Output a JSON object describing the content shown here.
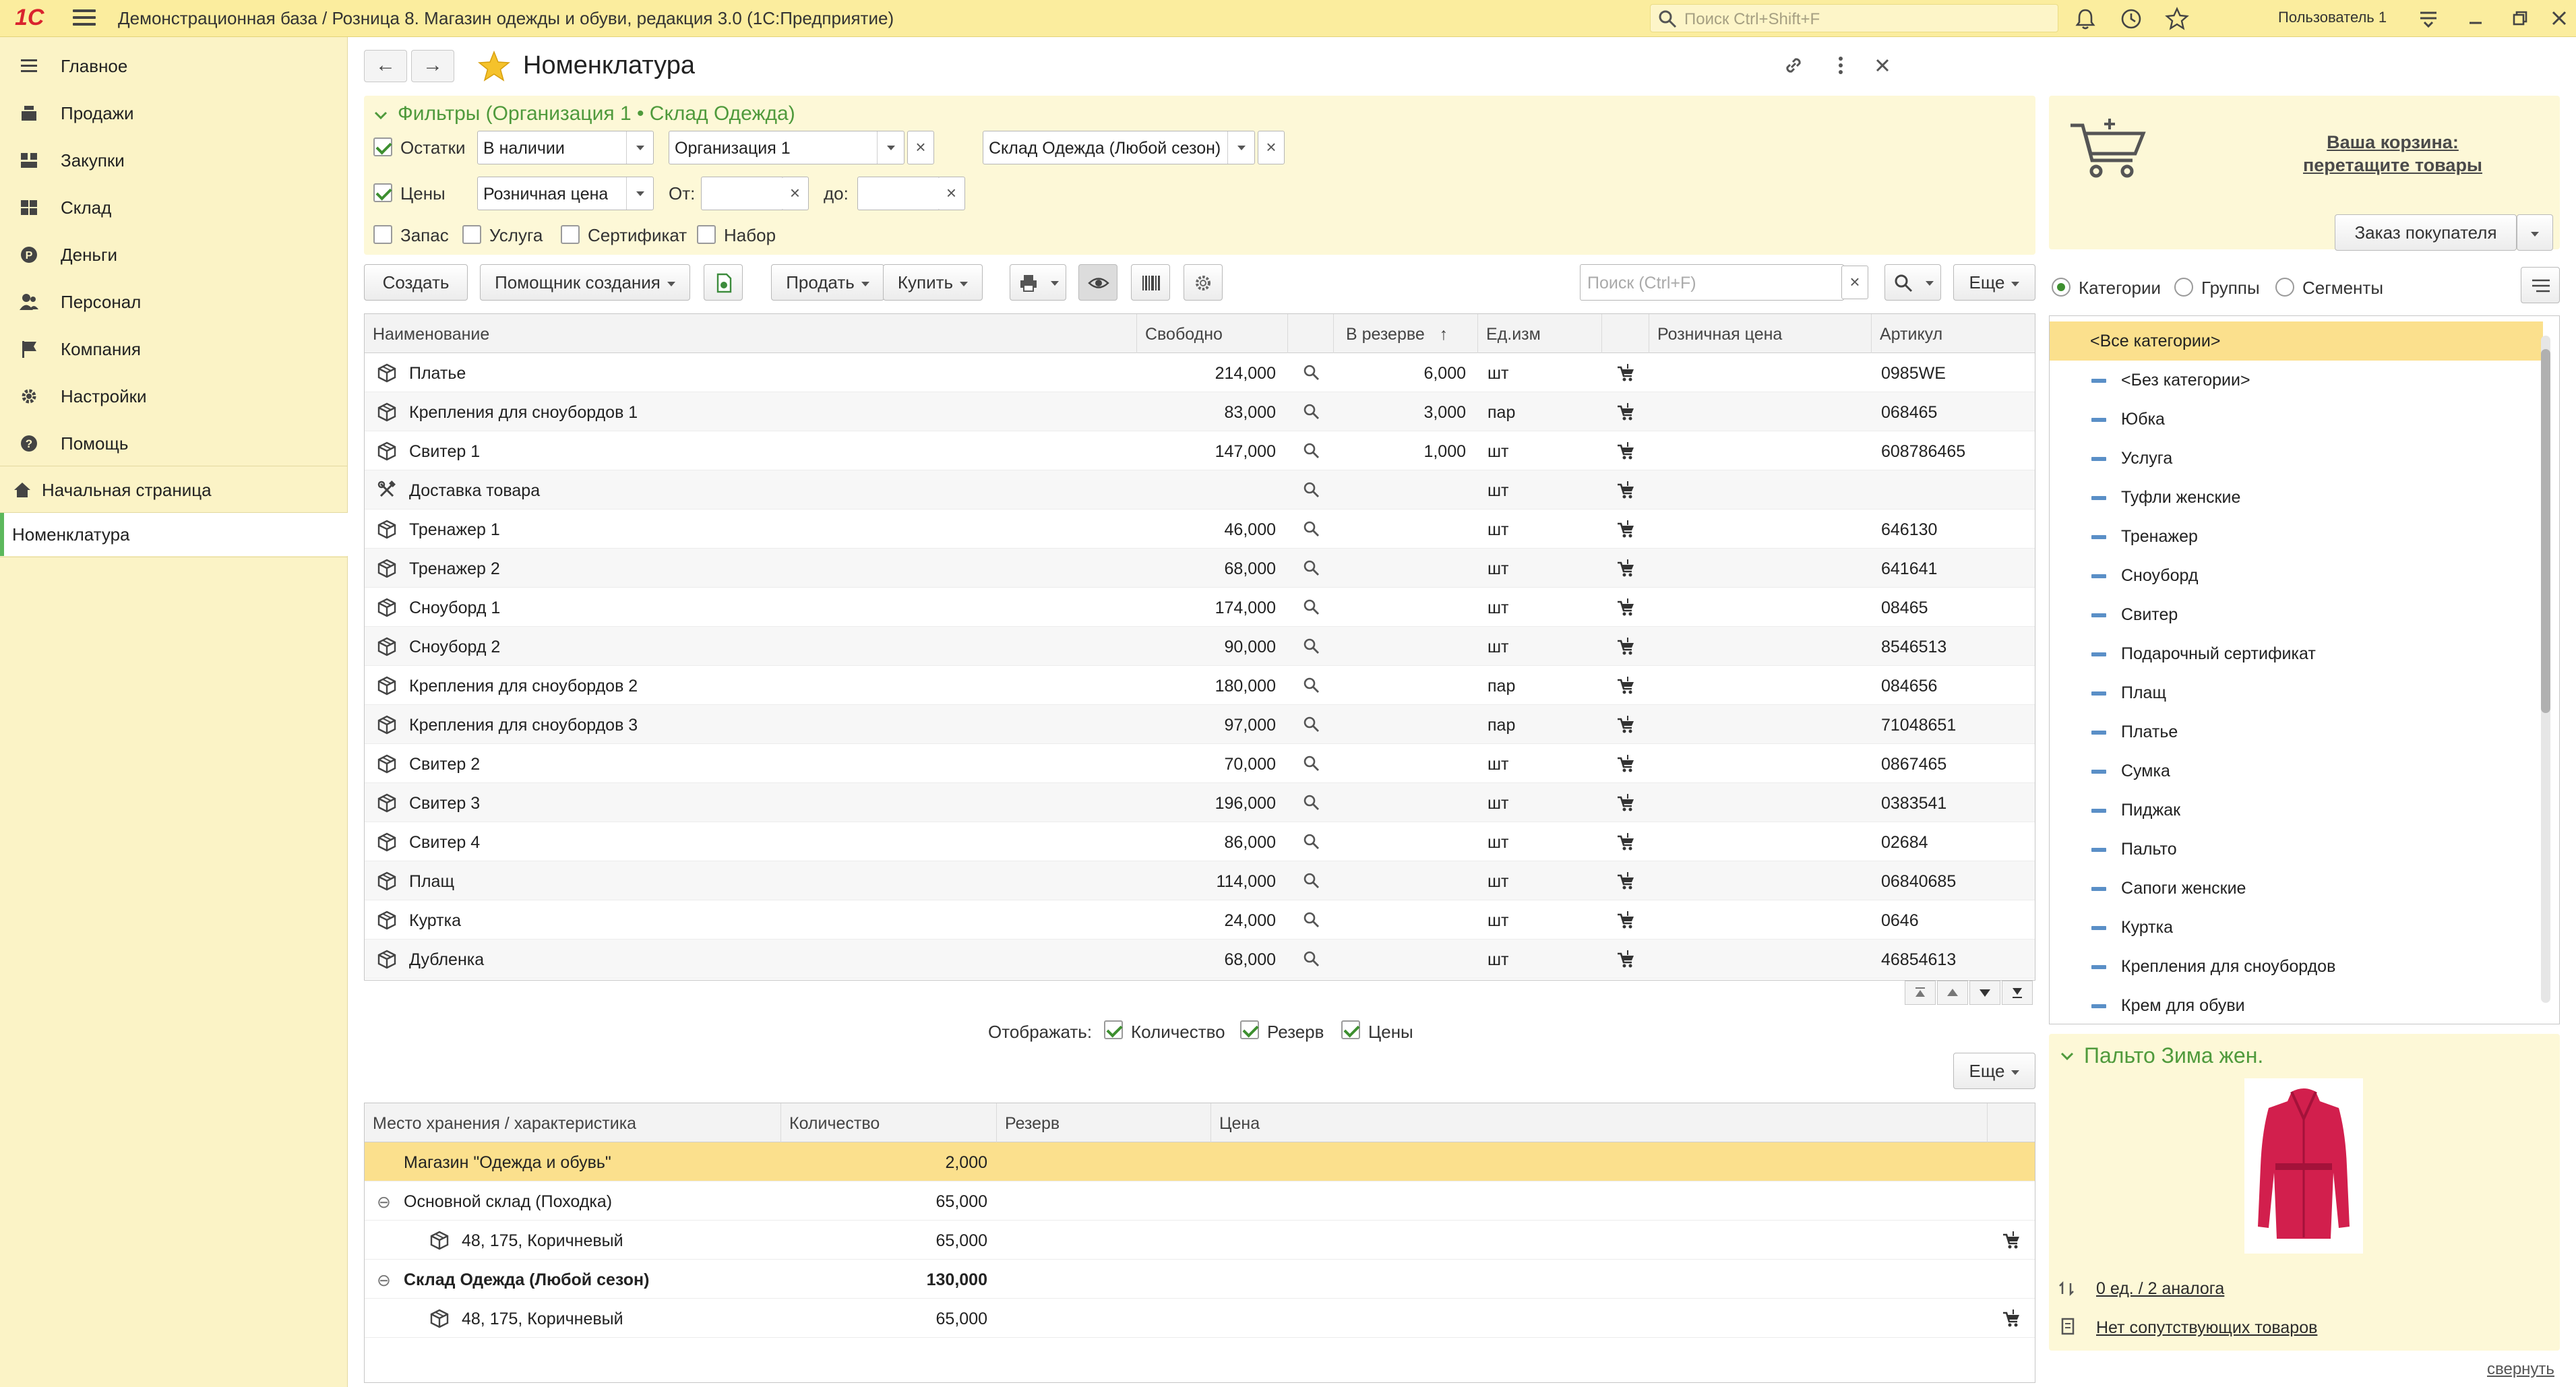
{
  "titlebar": {
    "logo": "1С",
    "title": "Демонстрационная база / Розница 8. Магазин одежды и обуви, редакция 3.0  (1С:Предприятие)",
    "search_placeholder": "Поиск Ctrl+Shift+F",
    "user": "Пользователь 1"
  },
  "sidebar": {
    "sections": [
      {
        "label": "Главное",
        "icon": "hamburger-icon"
      },
      {
        "label": "Продажи",
        "icon": "cash-register-icon"
      },
      {
        "label": "Закупки",
        "icon": "purchases-icon"
      },
      {
        "label": "Склад",
        "icon": "warehouse-icon"
      },
      {
        "label": "Деньги",
        "icon": "money-icon"
      },
      {
        "label": "Персонал",
        "icon": "people-icon"
      },
      {
        "label": "Компания",
        "icon": "flag-icon"
      },
      {
        "label": "Настройки",
        "icon": "gear-icon"
      },
      {
        "label": "Помощь",
        "icon": "help-icon"
      }
    ],
    "open_windows": [
      {
        "label": "Начальная страница",
        "icon": "home-icon"
      },
      {
        "label": "Номенклатура"
      }
    ]
  },
  "form": {
    "back": "←",
    "forward": "→",
    "title": "Номенклатура"
  },
  "filters": {
    "title": "Фильтры (Организация 1 • Склад Одежда)",
    "stock_label": "Остатки",
    "stock_value": "В наличии",
    "organization_value": "Организация 1",
    "warehouse_value": "Склад Одежда (Любой сезон)",
    "prices_label": "Цены",
    "price_type_value": "Розничная цена",
    "from_label": "От:",
    "to_label": "до:",
    "clear": "×",
    "types": [
      {
        "label": "Запас",
        "checked": false
      },
      {
        "label": "Услуга",
        "checked": false
      },
      {
        "label": "Сертификат",
        "checked": false
      },
      {
        "label": "Набор",
        "checked": false
      }
    ]
  },
  "toolbar": {
    "create": "Создать",
    "wizard": "Помощник создания",
    "sell": "Продать",
    "buy": "Купить",
    "search_placeholder": "Поиск (Ctrl+F)",
    "clear": "×",
    "more": "Еще"
  },
  "items_table": {
    "columns": [
      "Наименование",
      "Свободно",
      "В резерве",
      "Ед.изм",
      "Розничная цена",
      "Артикул"
    ],
    "sort_arrow": "↑",
    "rows": [
      {
        "name": "Платье",
        "free": "214,000",
        "reserve": "6,000",
        "unit": "шт",
        "article": "0985WE",
        "icon": "package-icon"
      },
      {
        "name": "Крепления для сноубордов 1",
        "free": "83,000",
        "reserve": "3,000",
        "unit": "пар",
        "article": "068465",
        "icon": "package-icon"
      },
      {
        "name": "Свитер 1",
        "free": "147,000",
        "reserve": "1,000",
        "unit": "шт",
        "article": "608786465",
        "icon": "package-icon"
      },
      {
        "name": "Доставка товара",
        "free": "",
        "reserve": "",
        "unit": "шт",
        "article": "",
        "icon": "service-icon"
      },
      {
        "name": "Тренажер 1",
        "free": "46,000",
        "reserve": "",
        "unit": "шт",
        "article": "646130",
        "icon": "package-icon"
      },
      {
        "name": "Тренажер 2",
        "free": "68,000",
        "reserve": "",
        "unit": "шт",
        "article": "641641",
        "icon": "package-icon"
      },
      {
        "name": "Сноуборд 1",
        "free": "174,000",
        "reserve": "",
        "unit": "шт",
        "article": "08465",
        "icon": "package-icon"
      },
      {
        "name": "Сноуборд 2",
        "free": "90,000",
        "reserve": "",
        "unit": "шт",
        "article": "8546513",
        "icon": "package-icon"
      },
      {
        "name": "Крепления для сноубордов 2",
        "free": "180,000",
        "reserve": "",
        "unit": "пар",
        "article": "084656",
        "icon": "package-icon"
      },
      {
        "name": "Крепления для сноубордов 3",
        "free": "97,000",
        "reserve": "",
        "unit": "пар",
        "article": "71048651",
        "icon": "package-icon"
      },
      {
        "name": "Свитер 2",
        "free": "70,000",
        "reserve": "",
        "unit": "шт",
        "article": "0867465",
        "icon": "package-icon"
      },
      {
        "name": "Свитер 3",
        "free": "196,000",
        "reserve": "",
        "unit": "шт",
        "article": "0383541",
        "icon": "package-icon"
      },
      {
        "name": "Свитер 4",
        "free": "86,000",
        "reserve": "",
        "unit": "шт",
        "article": "02684",
        "icon": "package-icon"
      },
      {
        "name": "Плащ",
        "free": "114,000",
        "reserve": "",
        "unit": "шт",
        "article": "06840685",
        "icon": "package-icon"
      },
      {
        "name": "Куртка",
        "free": "24,000",
        "reserve": "",
        "unit": "шт",
        "article": "0646",
        "icon": "package-icon"
      },
      {
        "name": "Дубленка",
        "free": "68,000",
        "reserve": "",
        "unit": "шт",
        "article": "46854613",
        "icon": "package-icon"
      }
    ]
  },
  "display": {
    "label": "Отображать:",
    "quantity": "Количество",
    "reserve": "Резерв",
    "prices": "Цены"
  },
  "stock_table": {
    "more": "Еще",
    "columns": [
      "Место хранения / характеристика",
      "Количество",
      "Резерв",
      "Цена"
    ],
    "rows": [
      {
        "place": "Магазин \"Одежда и обувь\"",
        "qty": "2,000",
        "level": 0,
        "bold": false,
        "selected": true,
        "expand": "",
        "cart": false
      },
      {
        "place": "Основной склад (Походка)",
        "qty": "65,000",
        "level": 0,
        "bold": false,
        "selected": false,
        "expand": "⊖",
        "cart": false
      },
      {
        "place": "48, 175, Коричневый",
        "qty": "65,000",
        "level": 1,
        "bold": false,
        "selected": false,
        "expand": "",
        "cart": true
      },
      {
        "place": "Склад Одежда (Любой сезон)",
        "qty": "130,000",
        "level": 0,
        "bold": true,
        "selected": false,
        "expand": "⊖",
        "cart": false
      },
      {
        "place": "48, 175, Коричневый",
        "qty": "65,000",
        "level": 1,
        "bold": false,
        "selected": false,
        "expand": "",
        "cart": true
      }
    ]
  },
  "basket": {
    "text_line1": "Ваша корзина:",
    "text_line2": "перетащите товары",
    "order_button": "Заказ покупателя"
  },
  "category_switch": {
    "options": [
      {
        "label": "Категории",
        "selected": true
      },
      {
        "label": "Группы",
        "selected": false
      },
      {
        "label": "Сегменты",
        "selected": false
      }
    ]
  },
  "categories": [
    "<Все категории>",
    "<Без категории>",
    "Юбка",
    "Услуга",
    "Туфли женские",
    "Тренажер",
    "Сноуборд",
    "Свитер",
    "Подарочный сертификат",
    "Плащ",
    "Платье",
    "Сумка",
    "Пиджак",
    "Пальто",
    "Сапоги женские",
    "Куртка",
    "Крепления для сноубордов",
    "Крем для обуви"
  ],
  "product": {
    "title": "Пальто Зима жен.",
    "analogs_link": "0 ед. / 2 аналога",
    "related_link": "Нет сопутствующих товаров",
    "image": "red-coat-image"
  },
  "collapse_link": "свернуть",
  "colors": {
    "accent_yellow": "#fbed9e",
    "selection": "#fbe08d",
    "filter_title_green": "#4f9a3c"
  }
}
